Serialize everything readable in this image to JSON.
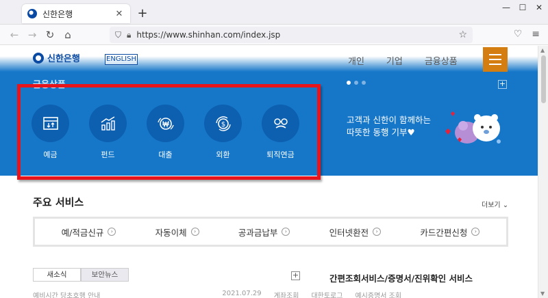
{
  "browser": {
    "tab_title": "신한은행",
    "tab_close": "✕",
    "new_tab": "+",
    "url": "https://www.shinhan.com/index.jsp",
    "window_buttons": [
      "—",
      "☐",
      "✕"
    ]
  },
  "header": {
    "logo_text": "신한은행",
    "lang_label": "ENGLISH",
    "menu": [
      "개인",
      "기업",
      "금융상품"
    ]
  },
  "hero": {
    "section_title": "금융상품",
    "products": [
      {
        "label": "예금",
        "icon": "deposit-icon"
      },
      {
        "label": "펀드",
        "icon": "fund-chart-icon"
      },
      {
        "label": "대출",
        "icon": "loan-won-icon"
      },
      {
        "label": "외환",
        "icon": "exchange-dollar-icon"
      },
      {
        "label": "퇴직연금",
        "icon": "pension-glasses-icon"
      }
    ],
    "promo_line1": "고객과 신한이 함께하는",
    "promo_line2": "따뜻한 동행 기부♥",
    "plus": "+"
  },
  "services": {
    "title": "주요 서비스",
    "more_label": "더보기",
    "items": [
      "예/적금신규",
      "자동이체",
      "공과금납부",
      "인터넷환전",
      "카드간편신청"
    ]
  },
  "news": {
    "tabs": [
      "새소식",
      "보안뉴스"
    ],
    "plus": "+",
    "cert_title": "간편조회서비스/증명서/진위확인 서비스",
    "line": [
      "예비시간 당초호행 안내",
      "2021.07.29",
      "계좌조회",
      "대한토로그",
      "예시증명서 조회"
    ]
  },
  "colors": {
    "hero_blue": "#1677c9",
    "circle_blue": "#0d5fb0",
    "menu_orange": "#d47d11",
    "highlight_red": "#e8141c"
  }
}
